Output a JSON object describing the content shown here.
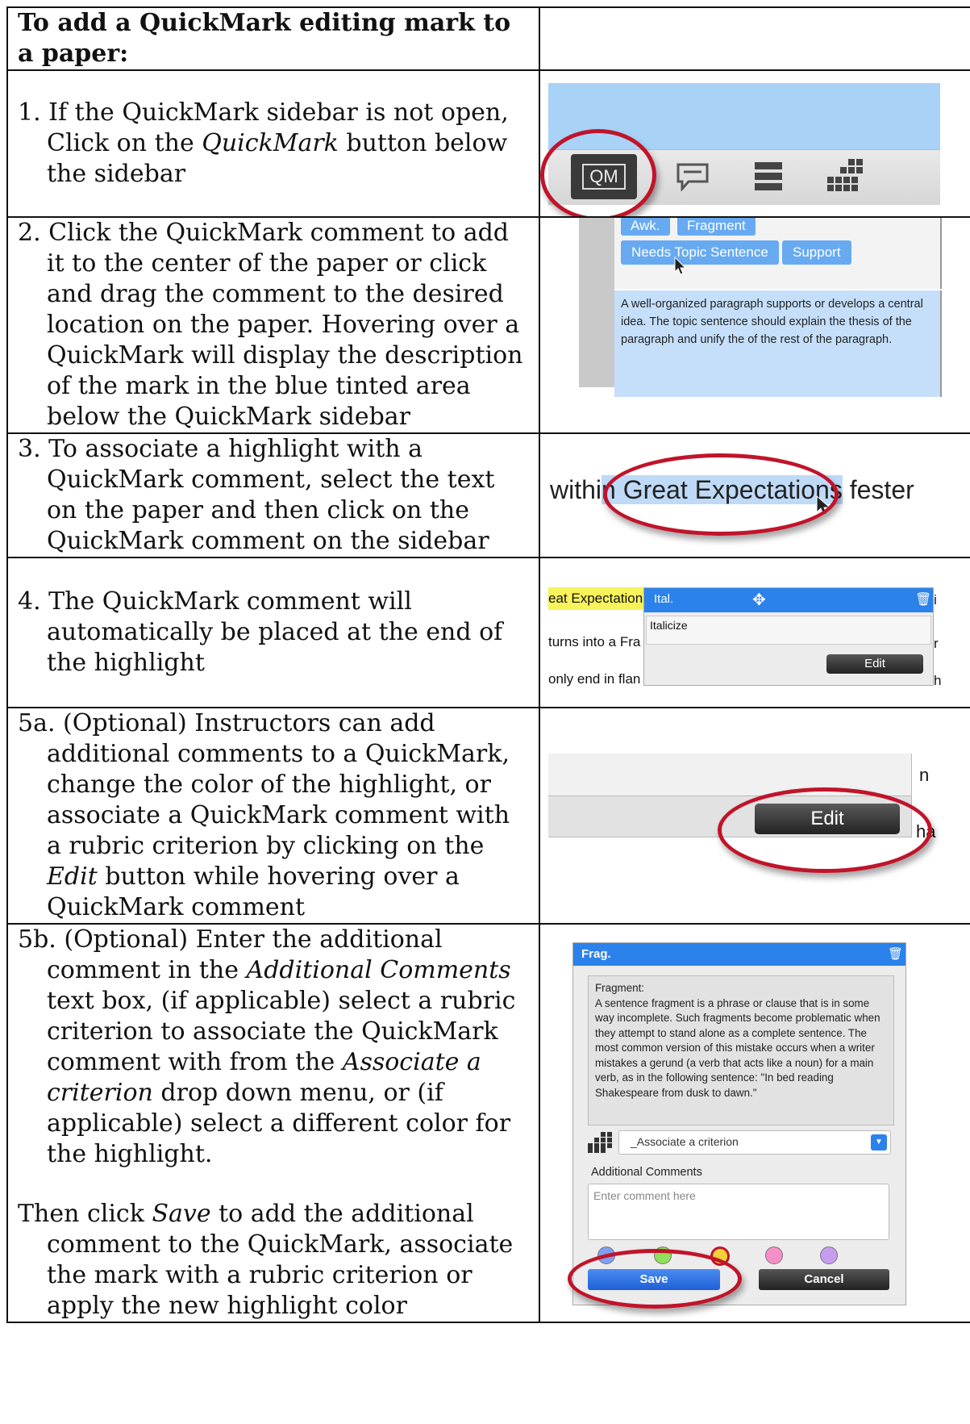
{
  "header": {
    "title": "To add a QuickMark editing mark to a paper:"
  },
  "steps": [
    {
      "prefix": "1. If the QuickMark sidebar is not open, Click on the ",
      "em": "QuickMark",
      "suffix": " button below the sidebar"
    },
    {
      "text": "2. Click the QuickMark comment to add it to the center of the paper or click and drag the comment to the desired location on the paper. Hovering over a QuickMark will display the description of the mark in the blue tinted area below the QuickMark sidebar"
    },
    {
      "text": "3. To associate a highlight with a QuickMark comment, select the text on the paper and then click on the QuickMark comment on the sidebar"
    },
    {
      "text": "4. The QuickMark comment will automatically be placed at the end of the highlight"
    },
    {
      "prefix": "5a. (Optional) Instructors can add additional comments to a QuickMark, change the color of the highlight, or associate a QuickMark comment with a rubric criterion by clicking on the ",
      "em": "Edit",
      "suffix": " button while hovering over a QuickMark comment"
    },
    {
      "p1_a": "5b. (Optional) Enter the additional comment in the ",
      "p1_em1": "Additional Comments",
      "p1_b": " text box, (if applicable) select a rubric criterion to associate the QuickMark comment with from the ",
      "p1_em2": "Associate a criterion",
      "p1_c": " drop down menu, or (if applicable) select a different color for the highlight.",
      "p2_a": "Then click ",
      "p2_em": "Save",
      "p2_b": " to add the additional comment to the QuickMark, associate the mark with a rubric criterion or apply the new highlight color"
    }
  ],
  "shot1": {
    "qm_label": "QM"
  },
  "shot2": {
    "chips": [
      "Awk.",
      "Fragment",
      "Needs Topic Sentence",
      "Support"
    ],
    "description": "A well-organized paragraph supports or develops a central idea. The topic sentence should explain the thesis of the paragraph and unify the of the rest of the paragraph."
  },
  "shot3": {
    "before": "withi",
    "highlight": "n Great Expectations",
    "after": " fester"
  },
  "shot4": {
    "line1": "eat Expectation",
    "line2": "turns into a Fra",
    "line3": "only end in flan",
    "title": "Ital.",
    "body": "Italicize",
    "edit": "Edit",
    "edge1": "i",
    "edge2": "r",
    "edge3": "h"
  },
  "shot5": {
    "edit": "Edit",
    "edge1": "n",
    "edge2": "ha"
  },
  "shot6": {
    "title": "Frag.",
    "desc_title": "Fragment:",
    "desc": "A sentence fragment is a phrase or clause that is in some way incomplete. Such fragments become problematic when they attempt to stand alone as a complete sentence. The most common version of this mistake occurs when a writer mistakes a gerund (a verb that acts like a noun) for a main verb, as in the following sentence: \"In bed reading Shakespeare from dusk to dawn.\"",
    "criterion": "_Associate a criterion",
    "additional_label": "Additional Comments",
    "placeholder": "Enter comment here",
    "save": "Save",
    "cancel": "Cancel",
    "colors": [
      "#7f9ff0",
      "#8fe05a",
      "#f2d23a",
      "#f58fc8",
      "#c79cf0"
    ]
  }
}
